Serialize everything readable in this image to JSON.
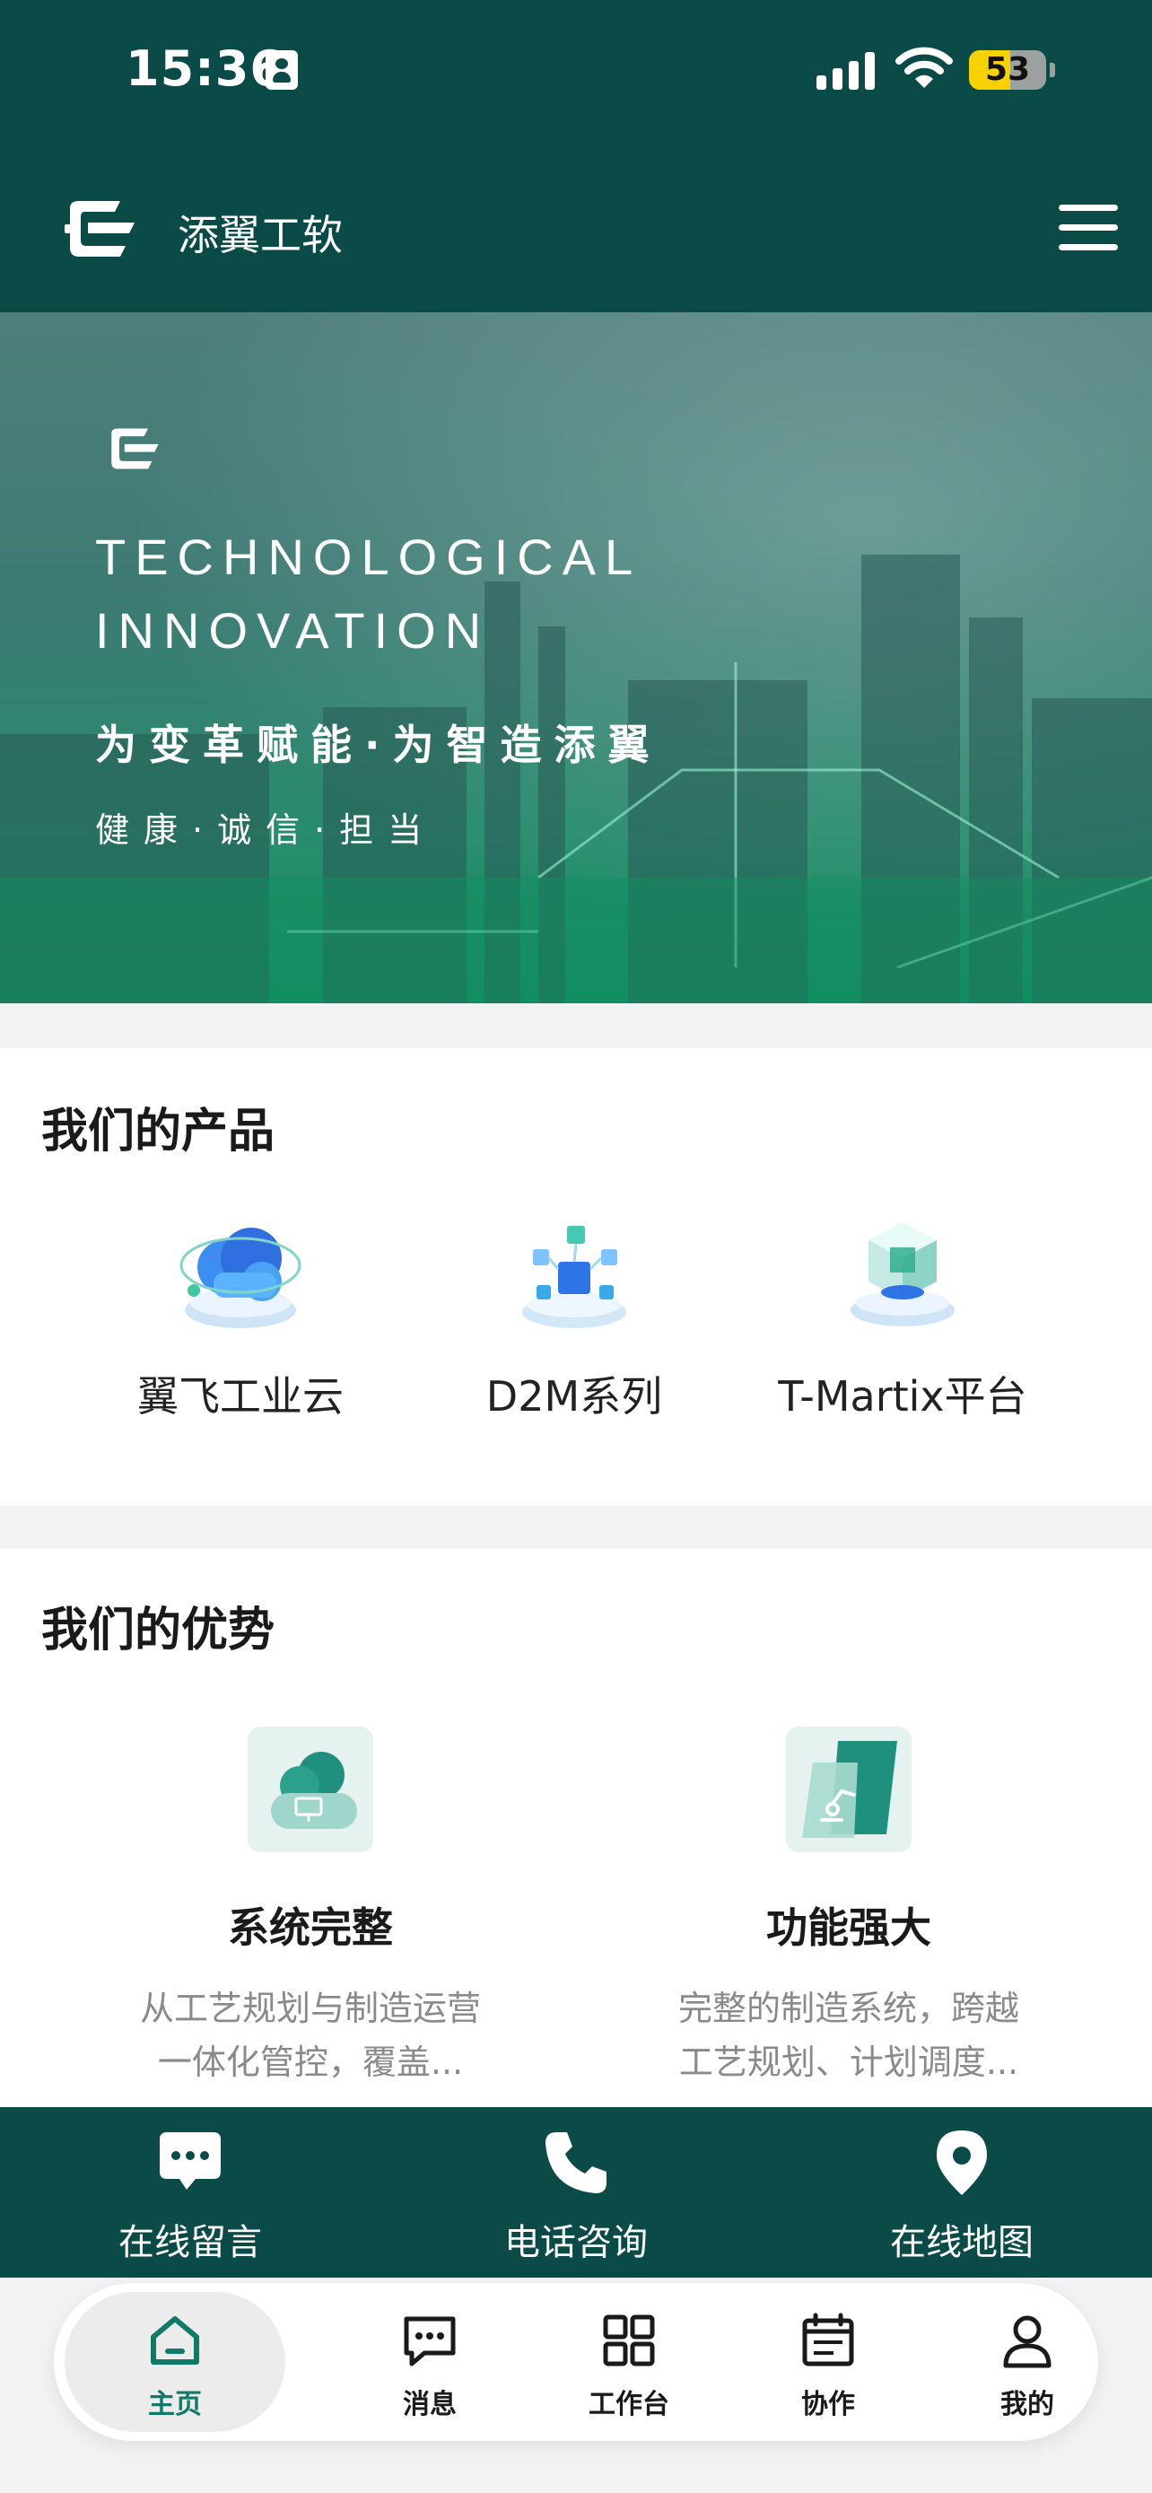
{
  "status_bar": {
    "time": "15:36",
    "battery": "53",
    "battery_level": 0.53
  },
  "header": {
    "brand": "添翼工软"
  },
  "hero": {
    "title_line1": "TECHNOLOGICAL",
    "title_line2": "INNOVATION",
    "slogan": "为变革赋能·为智造添翼",
    "values": "健康·诚信·担当"
  },
  "products": {
    "title": "我们的产品",
    "items": [
      {
        "label": "翼飞工业云"
      },
      {
        "label": "D2M系列"
      },
      {
        "label": "T-Martix平台"
      }
    ]
  },
  "advantages": {
    "title": "我们的优势",
    "items": [
      {
        "title": "系统完整",
        "desc_line1": "从工艺规划与制造运营",
        "desc_line2": "一体化管控，覆盖..."
      },
      {
        "title": "功能强大",
        "desc_line1": "完整的制造系统，跨越",
        "desc_line2": "工艺规划、计划调度..."
      }
    ]
  },
  "actions": [
    {
      "label": "在线留言",
      "icon": "message-bubble-icon"
    },
    {
      "label": "电话咨询",
      "icon": "phone-icon"
    },
    {
      "label": "在线地图",
      "icon": "map-pin-icon"
    }
  ],
  "tabbar": [
    {
      "label": "主页",
      "icon": "home-icon",
      "active": true
    },
    {
      "label": "消息",
      "icon": "chat-icon"
    },
    {
      "label": "工作台",
      "icon": "grid-icon"
    },
    {
      "label": "协作",
      "icon": "calendar-icon"
    },
    {
      "label": "我的",
      "icon": "user-icon"
    }
  ],
  "colors": {
    "primary": "#0a4a47",
    "accent": "#0e7a67",
    "hero_bottom": "#128f61"
  }
}
